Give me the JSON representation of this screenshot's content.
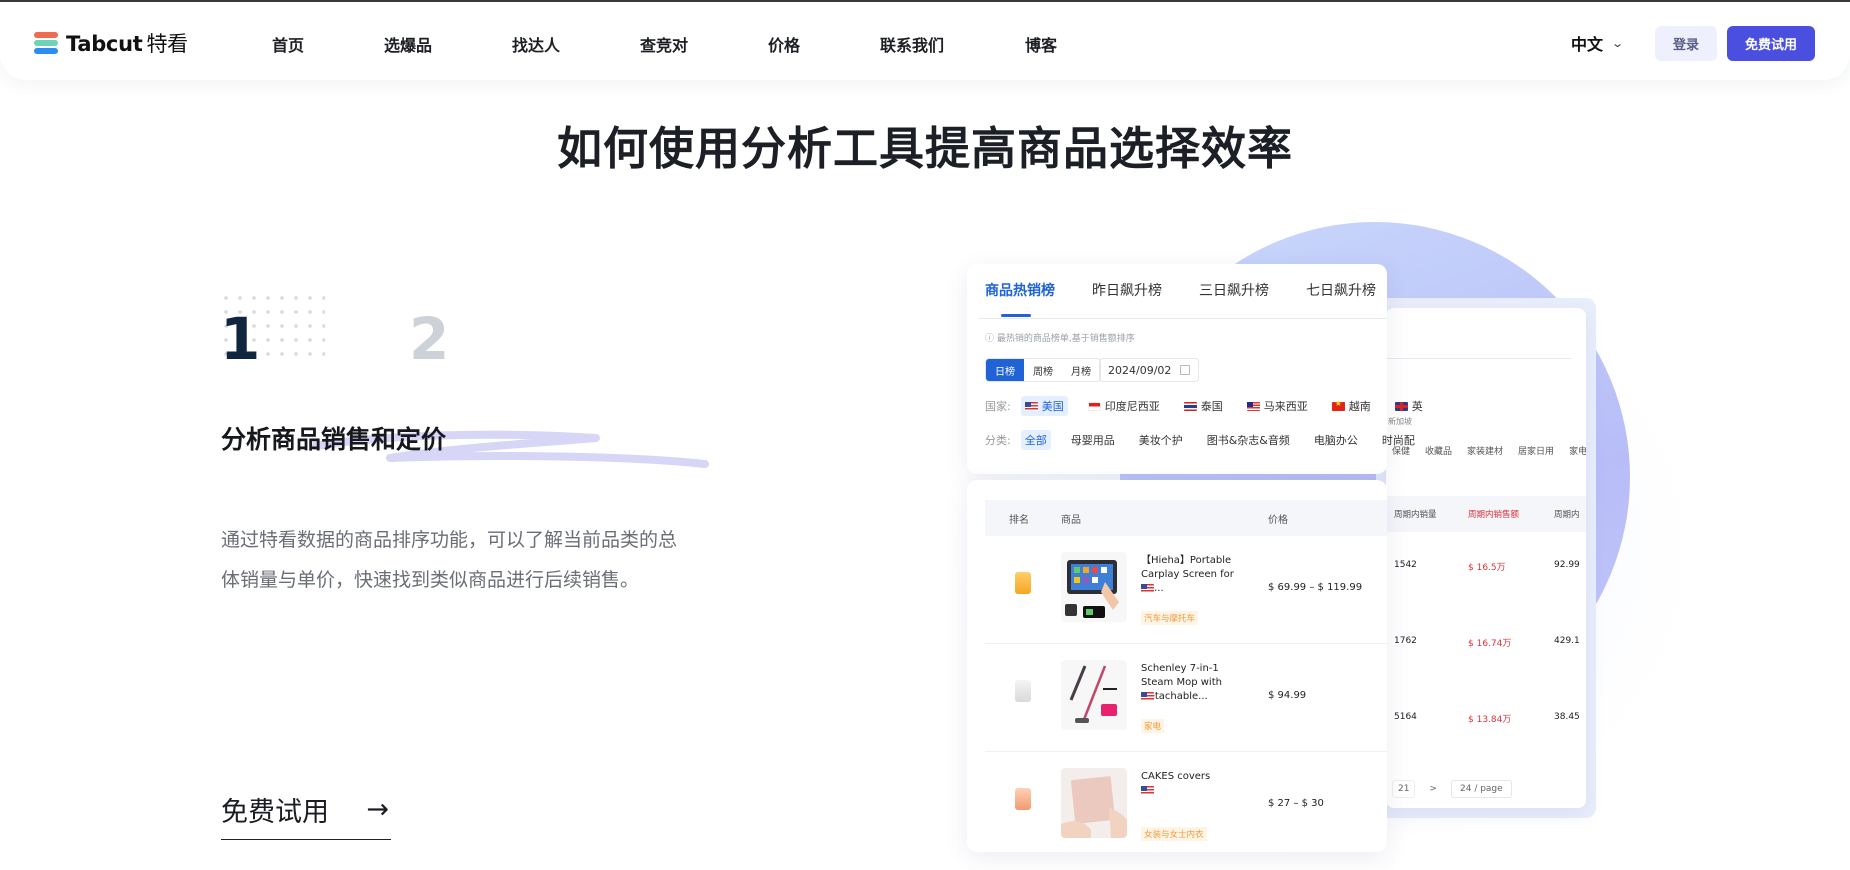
{
  "nav": {
    "brand": "Tabcut",
    "brand_cn": "特看",
    "links": [
      "首页",
      "选爆品",
      "找达人",
      "查竞对",
      "价格",
      "联系我们",
      "博客"
    ],
    "language": "中文",
    "login_label": "登录",
    "trial_label": "免费试用"
  },
  "page_title": "如何使用分析工具提高商品选择效率",
  "steps": [
    "1",
    "2"
  ],
  "active_step": 1,
  "section": {
    "title": "分析商品销售和定价",
    "description": "通过特看数据的商品排序功能，可以了解当前品类的总体销量与单价，快速找到类似商品进行后续销售。",
    "cta_label": "免费试用",
    "cta_arrow": "→"
  },
  "mockup": {
    "tabs": [
      "商品热销榜",
      "昨日飙升榜",
      "三日飙升榜",
      "七日飙升榜"
    ],
    "active_tab": 0,
    "hint": "ⓘ 最热销的商品榜单,基于销售额排序",
    "periods": [
      "日榜",
      "周榜",
      "月榜"
    ],
    "active_period": 0,
    "date": "2024/09/02",
    "country_label": "国家:",
    "countries": [
      {
        "name": "美国",
        "flag": "us"
      },
      {
        "name": "印度尼西亚",
        "flag": "id"
      },
      {
        "name": "泰国",
        "flag": "th"
      },
      {
        "name": "马来西亚",
        "flag": "my"
      },
      {
        "name": "越南",
        "flag": "vn"
      },
      {
        "name": "英",
        "flag": "gb"
      }
    ],
    "country_overflow": "新加坡",
    "category_label": "分类:",
    "categories": [
      "全部",
      "母婴用品",
      "美妆个护",
      "图书&杂志&音频",
      "电脑办公",
      "时尚配"
    ],
    "categories_more": [
      "保健",
      "收藏品",
      "家装建材",
      "居家日用",
      "家电"
    ],
    "table": {
      "headers": [
        "排名",
        "商品",
        "价格"
      ],
      "extra_headers": [
        "周期内销量",
        "周期内销售额",
        "周期内"
      ],
      "rows": [
        {
          "rank_medal": "gold",
          "title": "【Hieha】Portable Carplay Screen for Ca...",
          "flag": "us",
          "tag": "汽车与摩托车",
          "price": "$ 69.99 – $ 119.99",
          "sales": "1542",
          "revenue": "$ 16.5万",
          "extra": "92.99"
        },
        {
          "rank_medal": "silver",
          "title": "Schenley 7-in-1 Steam Mop with Detachable...",
          "flag": "us",
          "tag": "家电",
          "price": "$ 94.99",
          "sales": "1762",
          "revenue": "$ 16.74万",
          "extra": "429.1"
        },
        {
          "rank_medal": "bronze",
          "title": "CAKES covers",
          "flag": "us",
          "tag": "女装与女士内衣",
          "price": "$ 27 – $ 30",
          "sales": "5164",
          "revenue": "$ 13.84万",
          "extra": "38.45"
        }
      ]
    },
    "pagination": {
      "page": "21",
      "next": ">",
      "page_size": "24 / page"
    }
  },
  "colors": {
    "accent": "#4b4fe0",
    "tab_active": "#1f63d6",
    "revenue": "#e0323a"
  }
}
